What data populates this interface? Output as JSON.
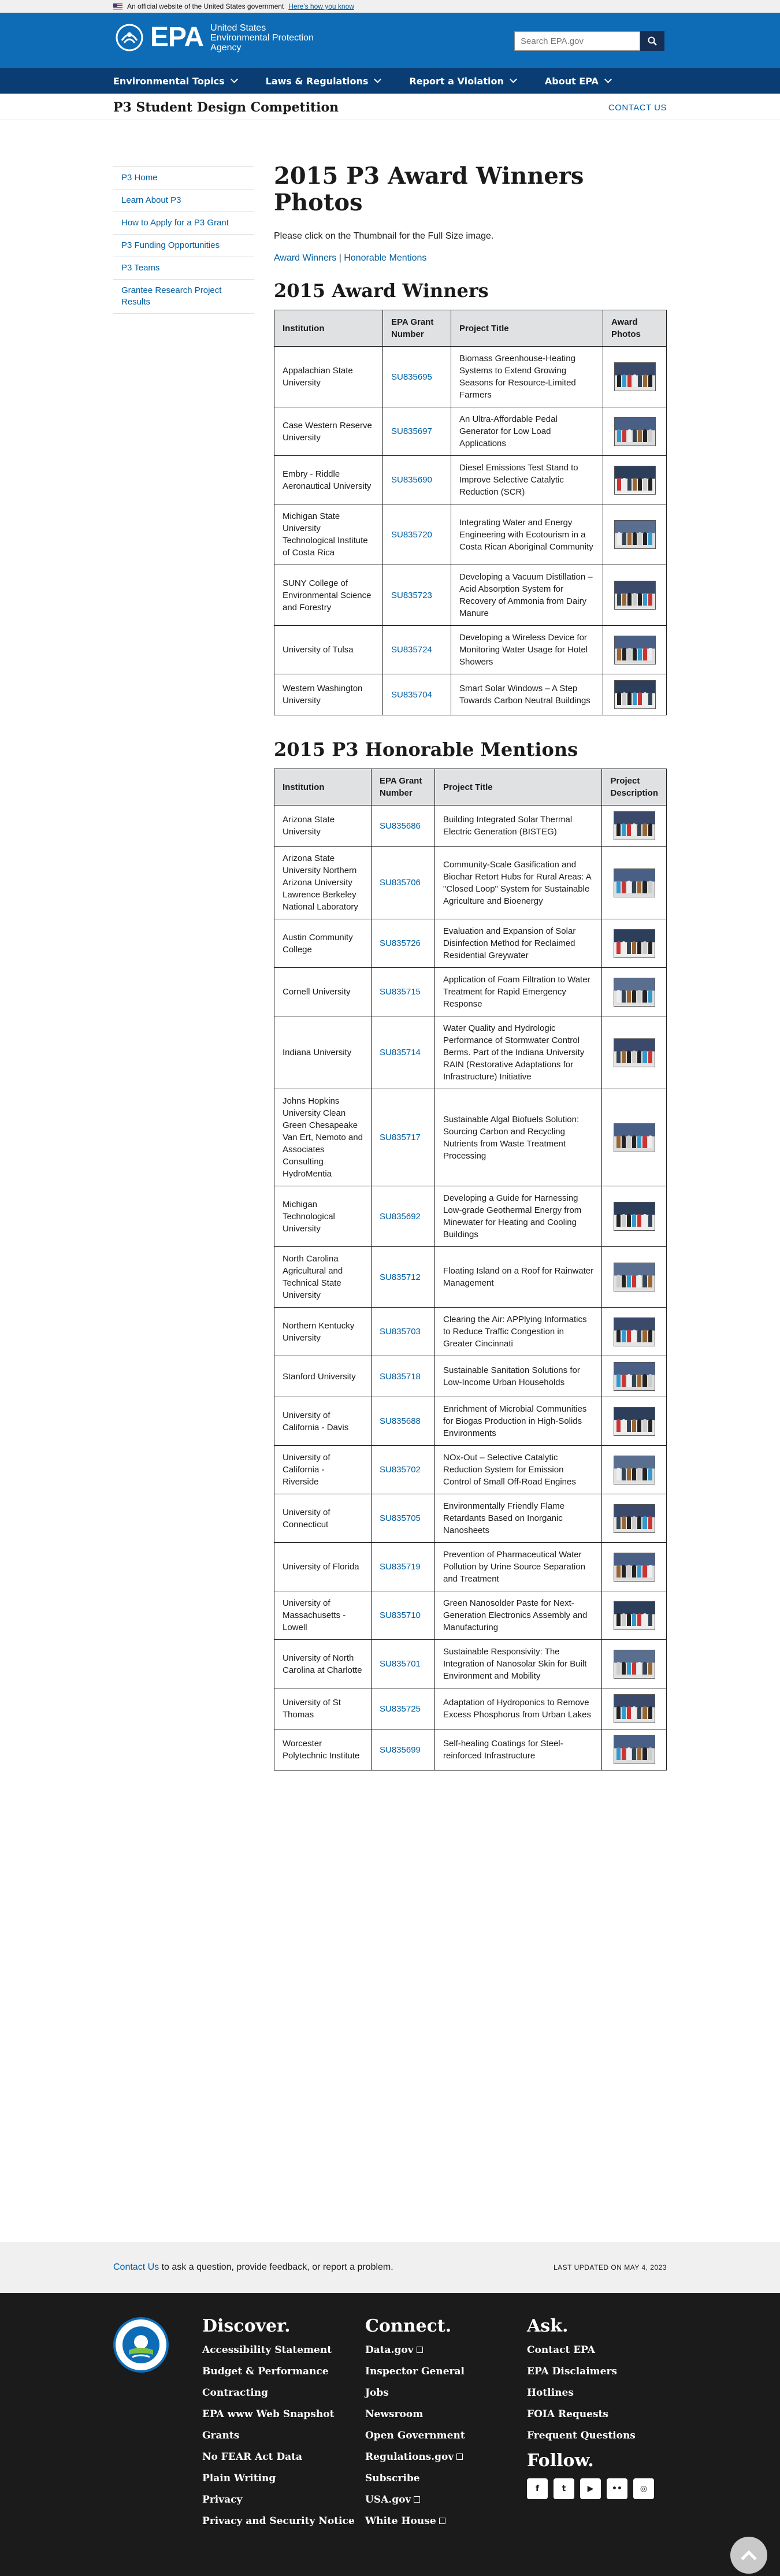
{
  "gov_banner": {
    "text": "An official website of the United States government",
    "link": "Here's how you know"
  },
  "header": {
    "logo_text": "EPA",
    "agency_name_line1": "United States",
    "agency_name_line2": "Environmental Protection",
    "agency_name_line3": "Agency",
    "search_placeholder": "Search EPA.gov"
  },
  "nav": {
    "items": [
      "Environmental Topics",
      "Laws & Regulations",
      "Report a Violation",
      "About EPA"
    ]
  },
  "subhead": {
    "title": "P3 Student Design Competition",
    "contact": "CONTACT US"
  },
  "sidenav": {
    "items": [
      "P3 Home",
      "Learn About P3",
      "How to Apply for a P3 Grant",
      "P3 Funding Opportunities",
      "P3 Teams",
      "Grantee Research Project Results"
    ]
  },
  "main": {
    "title": "2015 P3 Award Winners Photos",
    "intro": "Please click on the Thumbnail for the Full Size image.",
    "jump_winners": "Award Winners",
    "jump_sep": " | ",
    "jump_honorable": "Honorable Mentions",
    "winners_heading": "2015 Award Winners",
    "winners_cols": [
      "Institution",
      "EPA Grant Number",
      "Project Title",
      "Award Photos"
    ],
    "winners": [
      {
        "inst": "Appalachian State University",
        "grant": "SU835695",
        "title": "Biomass Greenhouse-Heating Systems to Extend Growing Seasons for Resource-Limited Farmers"
      },
      {
        "inst": "Case Western Reserve University",
        "grant": "SU835697",
        "title": "An Ultra-Affordable Pedal Generator for Low Load Applications"
      },
      {
        "inst": "Embry - Riddle Aeronautical University",
        "grant": "SU835690",
        "title": "Diesel Emissions Test Stand to Improve Selective Catalytic Reduction (SCR)"
      },
      {
        "inst": "Michigan State University Technological Institute of Costa Rica",
        "grant": "SU835720",
        "title": "Integrating Water and Energy Engineering with Ecotourism in a Costa Rican Aboriginal Community"
      },
      {
        "inst": "SUNY College of Environmental Science and Forestry",
        "grant": "SU835723",
        "title": "Developing a Vacuum Distillation – Acid Absorption System for Recovery of Ammonia from Dairy Manure"
      },
      {
        "inst": "University of Tulsa",
        "grant": "SU835724",
        "title": "Developing a Wireless Device for Monitoring Water Usage for Hotel Showers"
      },
      {
        "inst": "Western Washington University",
        "grant": "SU835704",
        "title": "Smart Solar Windows – A Step Towards Carbon Neutral Buildings"
      }
    ],
    "honorable_heading": "2015 P3 Honorable Mentions",
    "honorable_cols": [
      "Institution",
      "EPA Grant Number",
      "Project Title",
      "Project Description"
    ],
    "honorable": [
      {
        "inst": "Arizona State University",
        "grant": "SU835686",
        "title": "Building Integrated Solar Thermal Electric Generation (BISTEG)"
      },
      {
        "inst": "Arizona State University Northern Arizona University Lawrence Berkeley National Laboratory",
        "grant": "SU835706",
        "title": "Community-Scale Gasification and Biochar Retort Hubs for Rural Areas: A \"Closed Loop\" System for Sustainable Agriculture and Bioenergy"
      },
      {
        "inst": "Austin Community College",
        "grant": "SU835726",
        "title": "Evaluation and Expansion of Solar Disinfection Method for Reclaimed Residential Greywater"
      },
      {
        "inst": "Cornell University",
        "grant": "SU835715",
        "title": "Application of Foam Filtration to Water Treatment for Rapid Emergency Response"
      },
      {
        "inst": "Indiana University",
        "grant": "SU835714",
        "title": "Water Quality and Hydrologic Performance of Stormwater Control Berms. Part of the Indiana University RAIN (Restorative Adaptations for Infrastructure) Initiative"
      },
      {
        "inst": "Johns Hopkins University Clean Green Chesapeake Van Ert, Nemoto and Associates Consulting HydroMentia",
        "grant": "SU835717",
        "title": "Sustainable Algal Biofuels Solution: Sourcing Carbon and Recycling Nutrients from Waste Treatment Processing"
      },
      {
        "inst": "Michigan Technological University",
        "grant": "SU835692",
        "title": "Developing a Guide for Harnessing Low-grade Geothermal Energy from Minewater for Heating and Cooling Buildings"
      },
      {
        "inst": "North Carolina Agricultural and Technical State University",
        "grant": "SU835712",
        "title": "Floating Island on a Roof for Rainwater Management"
      },
      {
        "inst": "Northern Kentucky University",
        "grant": "SU835703",
        "title": "Clearing the Air: APPlying Informatics to Reduce Traffic Congestion in Greater Cincinnati"
      },
      {
        "inst": "Stanford University",
        "grant": "SU835718",
        "title": "Sustainable Sanitation Solutions for Low-Income Urban Households"
      },
      {
        "inst": "University of California - Davis",
        "grant": "SU835688",
        "title": "Enrichment of Microbial Communities for Biogas Production in High-Solids Environments"
      },
      {
        "inst": "University of California - Riverside",
        "grant": "SU835702",
        "title": "NOx-Out – Selective Catalytic Reduction System for Emission Control of Small Off-Road Engines"
      },
      {
        "inst": "University of Connecticut",
        "grant": "SU835705",
        "title": "Environmentally Friendly Flame Retardants Based on Inorganic Nanosheets"
      },
      {
        "inst": "University of Florida",
        "grant": "SU835719",
        "title": "Prevention of Pharmaceutical Water Pollution by Urine Source Separation and Treatment"
      },
      {
        "inst": "University of Massachusetts - Lowell",
        "grant": "SU835710",
        "title": "Green Nanosolder Paste for Next-Generation Electronics Assembly and Manufacturing"
      },
      {
        "inst": "University of North Carolina at Charlotte",
        "grant": "SU835701",
        "title": "Sustainable Responsivity: The Integration of Nanosolar Skin for Built Environment and Mobility"
      },
      {
        "inst": "University of St Thomas",
        "grant": "SU835725",
        "title": "Adaptation of Hydroponics to Remove Excess Phosphorus from Urban Lakes"
      },
      {
        "inst": "Worcester Polytechnic Institute",
        "grant": "SU835699",
        "title": "Self-healing Coatings for Steel-reinforced Infrastructure"
      }
    ]
  },
  "footer_top": {
    "contact_link": "Contact Us",
    "contact_text": " to ask a question, provide feedback, or report a problem.",
    "last_updated": "LAST UPDATED ON MAY 4, 2023"
  },
  "footer": {
    "discover": {
      "heading": "Discover.",
      "links": [
        "Accessibility Statement",
        "Budget & Performance",
        "Contracting",
        "EPA www Web Snapshot",
        "Grants",
        "No FEAR Act Data",
        "Plain Writing",
        "Privacy",
        "Privacy and Security Notice"
      ]
    },
    "connect": {
      "heading": "Connect.",
      "links": [
        "Data.gov",
        "Inspector General",
        "Jobs",
        "Newsroom",
        "Open Government",
        "Regulations.gov",
        "Subscribe",
        "USA.gov",
        "White House"
      ]
    },
    "ask": {
      "heading": "Ask.",
      "links": [
        "Contact EPA",
        "EPA Disclaimers",
        "Hotlines",
        "FOIA Requests",
        "Frequent Questions"
      ]
    },
    "follow": {
      "heading": "Follow.",
      "icons": [
        "facebook-icon",
        "twitter-icon",
        "youtube-icon",
        "flickr-icon",
        "instagram-icon"
      ]
    }
  },
  "colors": {
    "header": "#0e6cb6",
    "nav": "#0a3d73",
    "link": "#005ea2",
    "footer": "#1b1b1b"
  }
}
